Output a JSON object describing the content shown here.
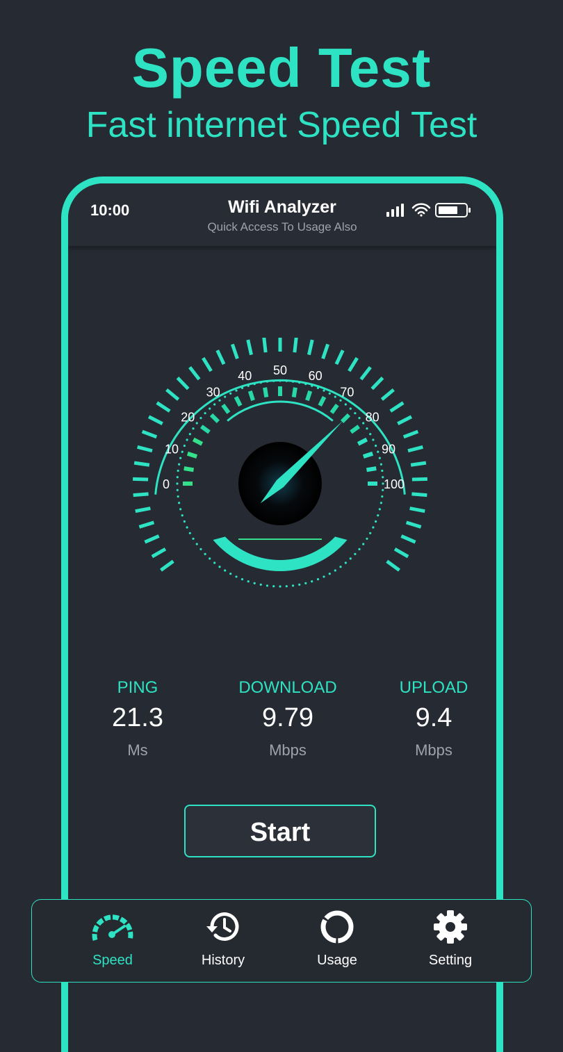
{
  "hero": {
    "title": "Speed Test",
    "subtitle": "Fast internet Speed Test"
  },
  "status_bar": {
    "time": "10:00",
    "icons": [
      "signal-icon",
      "wifi-icon",
      "battery-icon"
    ]
  },
  "app_header": {
    "title": "Wifi Analyzer",
    "subtitle": "Quick Access To Usage Also"
  },
  "gauge": {
    "scale_labels": [
      "0",
      "10",
      "20",
      "30",
      "40",
      "50",
      "60",
      "70",
      "80",
      "90",
      "100"
    ],
    "needle_value": 75
  },
  "stats": [
    {
      "label": "PING",
      "value": "21.3",
      "unit": "Ms"
    },
    {
      "label": "DOWNLOAD",
      "value": "9.79",
      "unit": "Mbps"
    },
    {
      "label": "UPLOAD",
      "value": "9.4",
      "unit": "Mbps"
    }
  ],
  "start_button": {
    "label": "Start"
  },
  "bottom_nav": {
    "items": [
      {
        "label": "Speed",
        "icon": "speedometer-icon",
        "active": true
      },
      {
        "label": "History",
        "icon": "history-icon",
        "active": false
      },
      {
        "label": "Usage",
        "icon": "usage-ring-icon",
        "active": false
      },
      {
        "label": "Setting",
        "icon": "gear-icon",
        "active": false
      }
    ]
  },
  "colors": {
    "accent": "#2ee3c3",
    "background": "#262a33",
    "text": "#ffffff",
    "muted": "#9ea3ab"
  }
}
